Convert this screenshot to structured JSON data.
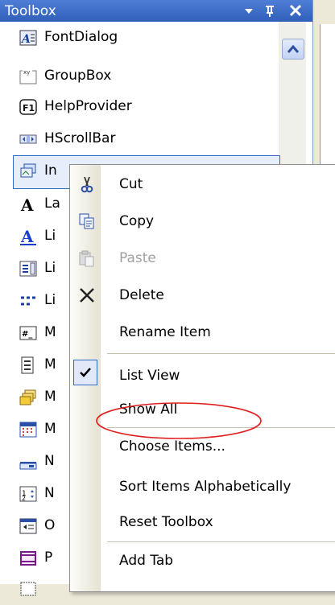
{
  "toolbox": {
    "title": "Toolbox",
    "icons": {
      "pin": "pin-icon",
      "close": "close-icon",
      "dropdown": "dropdown-arrow-icon"
    },
    "items": [
      {
        "label": "FontDialog",
        "icon": "font-dialog-icon"
      },
      {
        "label": "GroupBox",
        "icon": "group-box-icon"
      },
      {
        "label": "HelpProvider",
        "icon": "help-provider-icon"
      },
      {
        "label": "HScrollBar",
        "icon": "hscrollbar-icon"
      },
      {
        "label": "In",
        "icon": "image-list-icon"
      },
      {
        "label": "La",
        "icon": "label-icon"
      },
      {
        "label": "Li",
        "icon": "link-label-icon"
      },
      {
        "label": "Li",
        "icon": "list-box-icon"
      },
      {
        "label": "Li",
        "icon": "list-view-icon"
      },
      {
        "label": "M",
        "icon": "masked-textbox-icon"
      },
      {
        "label": "M",
        "icon": "menu-strip-icon"
      },
      {
        "label": "M",
        "icon": "message-queue-icon"
      },
      {
        "label": "M",
        "icon": "month-calendar-icon"
      },
      {
        "label": "N",
        "icon": "notify-icon-icon"
      },
      {
        "label": "N",
        "icon": "numeric-updown-icon"
      },
      {
        "label": "O",
        "icon": "open-file-dialog-icon"
      },
      {
        "label": "P",
        "icon": "panel-icon"
      },
      {
        "label": "",
        "icon": "print-icon"
      }
    ]
  },
  "context_menu": {
    "items": [
      {
        "label": "Cut",
        "icon": "scissors-icon"
      },
      {
        "label": "Copy",
        "icon": "copy-icon"
      },
      {
        "label": "Paste",
        "icon": "paste-icon",
        "disabled": true
      },
      {
        "label": "Delete",
        "icon": "delete-x-icon"
      },
      {
        "label": "Rename Item"
      },
      {
        "label": "List View",
        "icon": "check-icon",
        "checked": true
      },
      {
        "label": "Show All"
      },
      {
        "label": "Choose Items..."
      },
      {
        "label": "Sort Items Alphabetically"
      },
      {
        "label": "Reset Toolbox"
      },
      {
        "label": "Add Tab"
      }
    ],
    "highlight_color": "#e02020"
  },
  "colors": {
    "title_bar": "#3565c4",
    "accent": "#316ac5"
  }
}
